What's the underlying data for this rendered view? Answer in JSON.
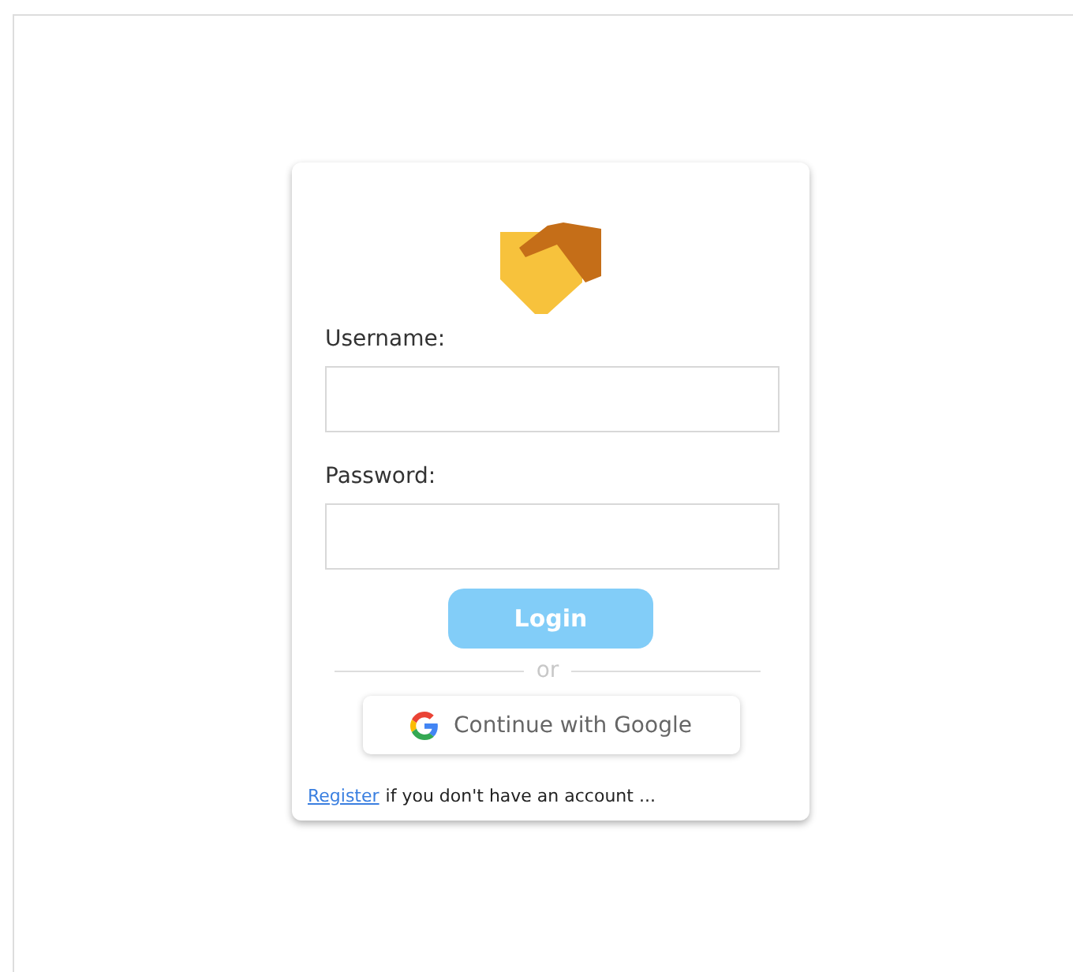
{
  "form": {
    "fields": [
      {
        "label": "Username:"
      },
      {
        "label": "Password:"
      }
    ],
    "login_button": {
      "label": "Login",
      "disabled": true
    },
    "divider": "or",
    "google_button": {
      "label": "Continue with Google"
    },
    "footer": {
      "link": "Register",
      "text": "if you don't have an account ..."
    }
  }
}
